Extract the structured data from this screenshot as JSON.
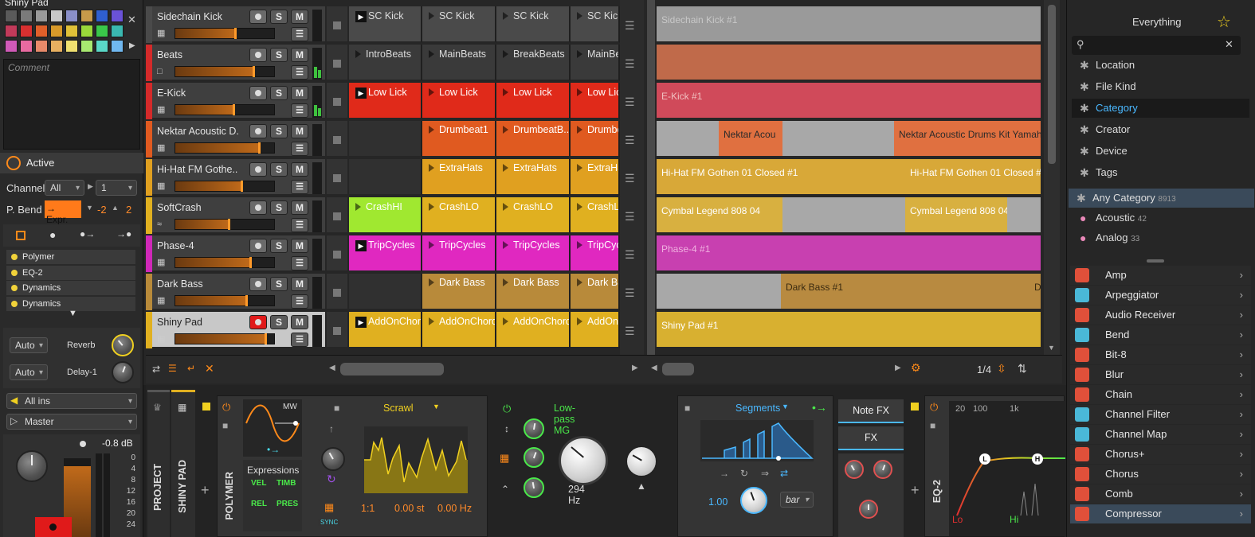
{
  "inspector": {
    "clip_name": "Shiny Pad",
    "comment_placeholder": "Comment",
    "active_label": "Active",
    "channel_label": "Channel",
    "channel_value": "All",
    "channel_num": "1",
    "pbend_label": "P. Bend",
    "expr_label": "→ Expr.",
    "pbend_down": "-2",
    "pbend_up": "2",
    "devices": [
      "Polymer",
      "EQ-2",
      "Dynamics",
      "Dynamics"
    ],
    "auto1": "Auto",
    "send1": "Reverb",
    "auto2": "Auto",
    "send2": "Delay-1",
    "input": "All ins",
    "output": "Master",
    "db": "-0.8 dB",
    "scale": [
      "0",
      "4",
      "8",
      "12",
      "16",
      "20",
      "24"
    ],
    "swatch_colors": [
      "#5a5a5a",
      "#7a7a7a",
      "#9a9a9a",
      "#c8c8c8",
      "#8a8fc8",
      "#c79a4a",
      "#2f5fd0",
      "#6a52d8",
      "#c23a5a",
      "#d93030",
      "#e0602a",
      "#d89a2a",
      "#e0c038",
      "#9ad83a",
      "#3ac84a",
      "#3ab8b0",
      "#d05ab8",
      "#e86aa0",
      "#e88a6a",
      "#e8b060",
      "#f0e070",
      "#a8e870",
      "#5ad8c8",
      "#70b8f0"
    ]
  },
  "tracks": [
    {
      "name": "Sidechain Kick",
      "color": "#4a4a4a",
      "vol": 0.62,
      "icon": "piano",
      "armed": false
    },
    {
      "name": "Beats",
      "color": "#d42a2a",
      "vol": 0.8,
      "icon": "folder",
      "armed": false
    },
    {
      "name": "E-Kick",
      "color": "#d42a2a",
      "vol": 0.6,
      "icon": "piano",
      "armed": false
    },
    {
      "name": "Nektar Acoustic D...",
      "color": "#e05a20",
      "vol": 0.86,
      "icon": "piano",
      "armed": false
    },
    {
      "name": "Hi-Hat FM Gothe...",
      "color": "#e0a020",
      "vol": 0.68,
      "icon": "piano",
      "armed": false
    },
    {
      "name": "SoftCrash",
      "color": "#e0b020",
      "vol": 0.55,
      "icon": "wave",
      "armed": false
    },
    {
      "name": "Phase-4",
      "color": "#d028b8",
      "vol": 0.77,
      "icon": "piano",
      "armed": false
    },
    {
      "name": "Dark Bass",
      "color": "#b88a3a",
      "vol": 0.73,
      "icon": "piano",
      "armed": false
    },
    {
      "name": "Shiny Pad",
      "color": "#e0b020",
      "vol": 0.92,
      "icon": "piano",
      "armed": true
    }
  ],
  "track_buttons": {
    "solo": "S",
    "mute": "M"
  },
  "clips": [
    [
      "SC Kick",
      "SC Kick",
      "SC Kick",
      "SC Kick"
    ],
    [
      "IntroBeats",
      "MainBeats",
      "BreakBeats",
      "MainBeats"
    ],
    [
      "Low Lick",
      "Low Lick",
      "Low Lick",
      "Low Lick"
    ],
    [
      "",
      "Drumbeat1",
      "DrumbeatB...",
      "Drumbeat"
    ],
    [
      "",
      "ExtraHats",
      "ExtraHats",
      "ExtraHats"
    ],
    [
      "CrashHI",
      "CrashLO",
      "CrashLO",
      "CrashLO"
    ],
    [
      "TripCycles",
      "TripCycles",
      "TripCycles",
      "TripCycles"
    ],
    [
      "",
      "Dark Bass",
      "Dark Bass",
      "Dark Bass"
    ],
    [
      "AddOnChord",
      "AddOnChord",
      "AddOnChord",
      "AddOnChord"
    ]
  ],
  "arranger": [
    [
      {
        "t": "Sidechain Kick #1"
      }
    ],
    [
      {
        "t": ""
      }
    ],
    [
      {
        "t": "E-Kick #1"
      }
    ],
    [
      {
        "t": "Nektar Acou"
      },
      {
        "t": "Nektar Acoustic Drums Kit Yamaha"
      }
    ],
    [
      {
        "t": "Hi-Hat FM Gothen 01 Closed #1"
      },
      {
        "t": "Hi-Hat FM Gothen 01 Closed #"
      }
    ],
    [
      {
        "t": "Cymbal Legend 808 04"
      },
      {
        "t": "Cymbal Legend 808 04"
      }
    ],
    [
      {
        "t": "Phase-4 #1"
      }
    ],
    [
      {
        "t": "Dark Bass #1"
      },
      {
        "t": "D"
      }
    ],
    [
      {
        "t": "Shiny Pad #1"
      }
    ]
  ],
  "footer": {
    "zoom": "1/4"
  },
  "browser": {
    "title": "Everything",
    "search_placeholder": "",
    "filters": [
      "Location",
      "File Kind",
      "Category",
      "Creator",
      "Device",
      "Tags"
    ],
    "selected_filter": "Category",
    "categories": [
      {
        "name": "Any Category",
        "count": "8913"
      },
      {
        "name": "Acoustic",
        "count": "42"
      },
      {
        "name": "Analog",
        "count": "33"
      }
    ],
    "devices": [
      {
        "name": "Amp",
        "c": "#e0503a"
      },
      {
        "name": "Arpeggiator",
        "c": "#4ab8d8"
      },
      {
        "name": "Audio Receiver",
        "c": "#e0503a"
      },
      {
        "name": "Bend",
        "c": "#4ab8d8"
      },
      {
        "name": "Bit-8",
        "c": "#e0503a"
      },
      {
        "name": "Blur",
        "c": "#e0503a"
      },
      {
        "name": "Chain",
        "c": "#e0503a"
      },
      {
        "name": "Channel Filter",
        "c": "#4ab8d8"
      },
      {
        "name": "Channel Map",
        "c": "#4ab8d8"
      },
      {
        "name": "Chorus+",
        "c": "#e0503a"
      },
      {
        "name": "Chorus",
        "c": "#e0503a"
      },
      {
        "name": "Comb",
        "c": "#e0503a"
      },
      {
        "name": "Compressor",
        "c": "#e0503a"
      }
    ]
  },
  "chain": {
    "project_tab": "PROJECT",
    "track_tab": "SHINY PAD",
    "polymer_label": "POLYMER",
    "mw": "MW",
    "expressions": "Expressions",
    "vel": "VEL",
    "timb": "TIMB",
    "rel": "REL",
    "pres": "PRES",
    "wave_name": "Scrawl",
    "ratio": "1:1",
    "st": "0.00 st",
    "hz": "0.00 Hz",
    "sync": "SYNC",
    "filter_name": "Low-pass MG",
    "cutoff": "294 Hz",
    "env_name": "Segments",
    "env_val": "1.00",
    "env_mode": "bar",
    "note_fx": "Note FX",
    "fx": "FX",
    "eq_label": "EQ-2",
    "eq_freqs": [
      "20",
      "100",
      "1k"
    ],
    "eq_lo": "Lo",
    "eq_hi": "Hi"
  }
}
